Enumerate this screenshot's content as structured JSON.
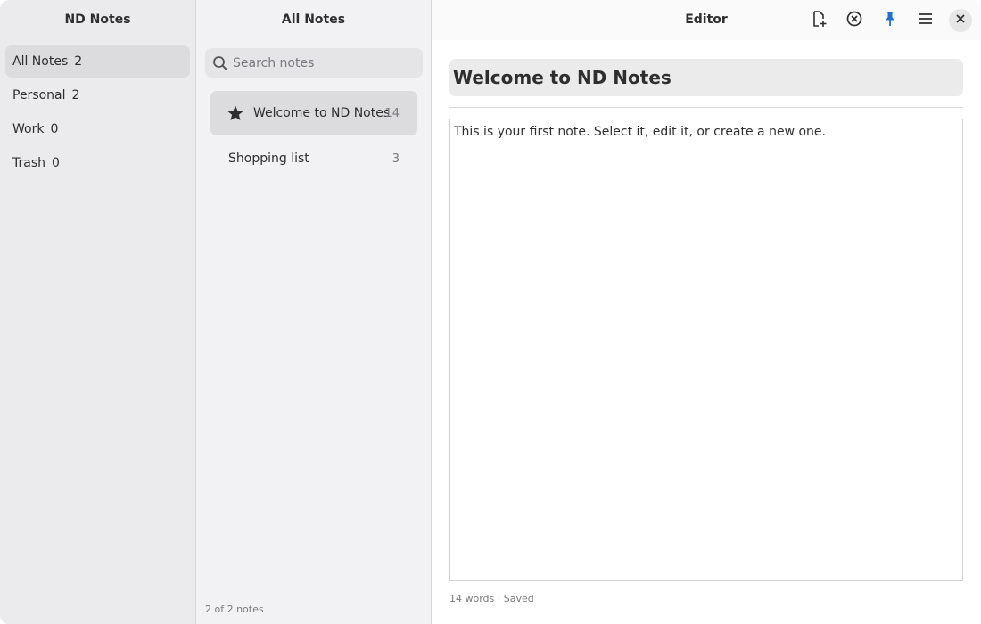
{
  "sidebar": {
    "title": "ND Notes",
    "items": [
      {
        "label": "All Notes",
        "count": "2"
      },
      {
        "label": "Personal",
        "count": "2"
      },
      {
        "label": "Work",
        "count": "0"
      },
      {
        "label": "Trash",
        "count": "0"
      }
    ],
    "selected_index": 0
  },
  "notes_list": {
    "title": "All Notes",
    "search_placeholder": "Search notes",
    "search_value": "",
    "notes": [
      {
        "title": "Welcome to ND Notes",
        "count": "14",
        "starred": true,
        "selected": true
      },
      {
        "title": "Shopping list",
        "count": "3",
        "starred": false,
        "selected": false
      }
    ],
    "footer": "2 of 2 notes"
  },
  "editor": {
    "title": "Editor",
    "note_title": "Welcome to ND Notes",
    "note_body": "This is your first note. Select it, edit it, or create a new one.",
    "status": "14 words · Saved",
    "toolbar_icons": [
      "new-note-icon",
      "discard-icon",
      "pin-icon",
      "menu-icon",
      "close-icon"
    ],
    "pin_color": "#1c71d8"
  },
  "colors": {
    "sidebar_bg": "#ebebed",
    "list_bg": "#f2f2f4",
    "selection": "#dcdcdf",
    "accent": "#1c71d8"
  }
}
